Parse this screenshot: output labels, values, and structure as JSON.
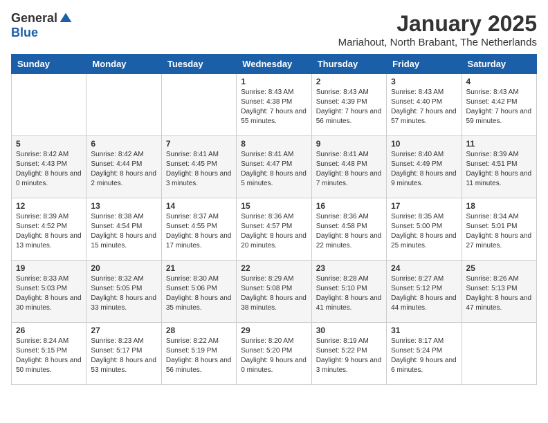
{
  "header": {
    "logo_general": "General",
    "logo_blue": "Blue",
    "month_title": "January 2025",
    "location": "Mariahout, North Brabant, The Netherlands"
  },
  "weekdays": [
    "Sunday",
    "Monday",
    "Tuesday",
    "Wednesday",
    "Thursday",
    "Friday",
    "Saturday"
  ],
  "weeks": [
    [
      {
        "day": "",
        "info": ""
      },
      {
        "day": "",
        "info": ""
      },
      {
        "day": "",
        "info": ""
      },
      {
        "day": "1",
        "info": "Sunrise: 8:43 AM\nSunset: 4:38 PM\nDaylight: 7 hours\nand 55 minutes."
      },
      {
        "day": "2",
        "info": "Sunrise: 8:43 AM\nSunset: 4:39 PM\nDaylight: 7 hours\nand 56 minutes."
      },
      {
        "day": "3",
        "info": "Sunrise: 8:43 AM\nSunset: 4:40 PM\nDaylight: 7 hours\nand 57 minutes."
      },
      {
        "day": "4",
        "info": "Sunrise: 8:43 AM\nSunset: 4:42 PM\nDaylight: 7 hours\nand 59 minutes."
      }
    ],
    [
      {
        "day": "5",
        "info": "Sunrise: 8:42 AM\nSunset: 4:43 PM\nDaylight: 8 hours\nand 0 minutes."
      },
      {
        "day": "6",
        "info": "Sunrise: 8:42 AM\nSunset: 4:44 PM\nDaylight: 8 hours\nand 2 minutes."
      },
      {
        "day": "7",
        "info": "Sunrise: 8:41 AM\nSunset: 4:45 PM\nDaylight: 8 hours\nand 3 minutes."
      },
      {
        "day": "8",
        "info": "Sunrise: 8:41 AM\nSunset: 4:47 PM\nDaylight: 8 hours\nand 5 minutes."
      },
      {
        "day": "9",
        "info": "Sunrise: 8:41 AM\nSunset: 4:48 PM\nDaylight: 8 hours\nand 7 minutes."
      },
      {
        "day": "10",
        "info": "Sunrise: 8:40 AM\nSunset: 4:49 PM\nDaylight: 8 hours\nand 9 minutes."
      },
      {
        "day": "11",
        "info": "Sunrise: 8:39 AM\nSunset: 4:51 PM\nDaylight: 8 hours\nand 11 minutes."
      }
    ],
    [
      {
        "day": "12",
        "info": "Sunrise: 8:39 AM\nSunset: 4:52 PM\nDaylight: 8 hours\nand 13 minutes."
      },
      {
        "day": "13",
        "info": "Sunrise: 8:38 AM\nSunset: 4:54 PM\nDaylight: 8 hours\nand 15 minutes."
      },
      {
        "day": "14",
        "info": "Sunrise: 8:37 AM\nSunset: 4:55 PM\nDaylight: 8 hours\nand 17 minutes."
      },
      {
        "day": "15",
        "info": "Sunrise: 8:36 AM\nSunset: 4:57 PM\nDaylight: 8 hours\nand 20 minutes."
      },
      {
        "day": "16",
        "info": "Sunrise: 8:36 AM\nSunset: 4:58 PM\nDaylight: 8 hours\nand 22 minutes."
      },
      {
        "day": "17",
        "info": "Sunrise: 8:35 AM\nSunset: 5:00 PM\nDaylight: 8 hours\nand 25 minutes."
      },
      {
        "day": "18",
        "info": "Sunrise: 8:34 AM\nSunset: 5:01 PM\nDaylight: 8 hours\nand 27 minutes."
      }
    ],
    [
      {
        "day": "19",
        "info": "Sunrise: 8:33 AM\nSunset: 5:03 PM\nDaylight: 8 hours\nand 30 minutes."
      },
      {
        "day": "20",
        "info": "Sunrise: 8:32 AM\nSunset: 5:05 PM\nDaylight: 8 hours\nand 33 minutes."
      },
      {
        "day": "21",
        "info": "Sunrise: 8:30 AM\nSunset: 5:06 PM\nDaylight: 8 hours\nand 35 minutes."
      },
      {
        "day": "22",
        "info": "Sunrise: 8:29 AM\nSunset: 5:08 PM\nDaylight: 8 hours\nand 38 minutes."
      },
      {
        "day": "23",
        "info": "Sunrise: 8:28 AM\nSunset: 5:10 PM\nDaylight: 8 hours\nand 41 minutes."
      },
      {
        "day": "24",
        "info": "Sunrise: 8:27 AM\nSunset: 5:12 PM\nDaylight: 8 hours\nand 44 minutes."
      },
      {
        "day": "25",
        "info": "Sunrise: 8:26 AM\nSunset: 5:13 PM\nDaylight: 8 hours\nand 47 minutes."
      }
    ],
    [
      {
        "day": "26",
        "info": "Sunrise: 8:24 AM\nSunset: 5:15 PM\nDaylight: 8 hours\nand 50 minutes."
      },
      {
        "day": "27",
        "info": "Sunrise: 8:23 AM\nSunset: 5:17 PM\nDaylight: 8 hours\nand 53 minutes."
      },
      {
        "day": "28",
        "info": "Sunrise: 8:22 AM\nSunset: 5:19 PM\nDaylight: 8 hours\nand 56 minutes."
      },
      {
        "day": "29",
        "info": "Sunrise: 8:20 AM\nSunset: 5:20 PM\nDaylight: 9 hours\nand 0 minutes."
      },
      {
        "day": "30",
        "info": "Sunrise: 8:19 AM\nSunset: 5:22 PM\nDaylight: 9 hours\nand 3 minutes."
      },
      {
        "day": "31",
        "info": "Sunrise: 8:17 AM\nSunset: 5:24 PM\nDaylight: 9 hours\nand 6 minutes."
      },
      {
        "day": "",
        "info": ""
      }
    ]
  ]
}
